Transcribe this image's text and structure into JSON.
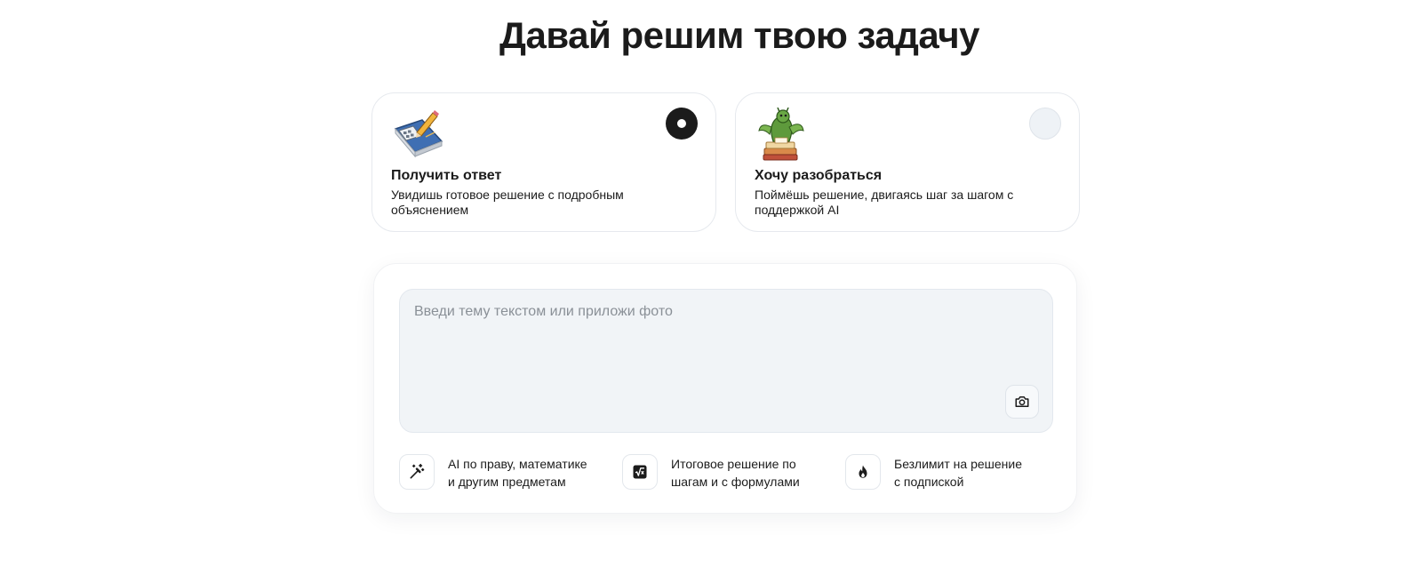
{
  "page": {
    "title": "Давай решим твою задачу"
  },
  "modes": [
    {
      "title": "Получить ответ",
      "description": "Увидишь готовое решение с подробным объяснением",
      "selected": true,
      "illustration": "math-textbook-icon"
    },
    {
      "title": "Хочу разобраться",
      "description": "Поймёшь решение, двигаясь шаг за шагом с поддержкой AI",
      "selected": false,
      "illustration": "dragon-reading-icon"
    }
  ],
  "input": {
    "placeholder": "Введи тему текстом или приложи фото",
    "value": "",
    "attach_icon": "camera-icon"
  },
  "features": [
    {
      "icon": "magic-wand-icon",
      "line1": "AI по праву, математике",
      "line2": "и другим предметам"
    },
    {
      "icon": "square-root-icon",
      "line1": "Итоговое решение по",
      "line2": "шагам и с формулами"
    },
    {
      "icon": "flame-icon",
      "line1": "Безлимит на решение",
      "line2": "с подпиской"
    }
  ],
  "colors": {
    "accent": "#1b1b1b",
    "input_bg": "#f1f4f7",
    "card_border": "#e6e9ee"
  }
}
